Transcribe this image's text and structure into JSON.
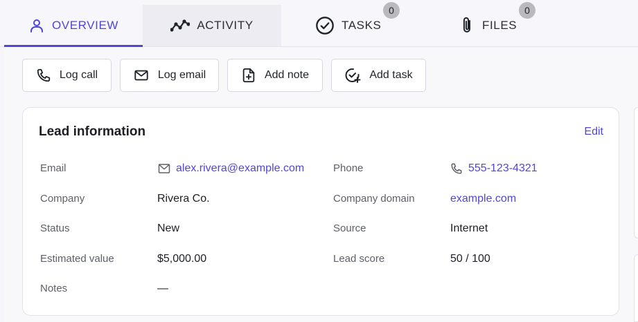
{
  "tabs": [
    {
      "label": "OVERVIEW",
      "icon": "user-icon",
      "active": true
    },
    {
      "label": "ACTIVITY",
      "icon": "activity-icon"
    },
    {
      "label": "TASKS",
      "icon": "check-circle-icon",
      "badge": "0"
    },
    {
      "label": "FILES",
      "icon": "paperclip-icon",
      "badge": "0"
    }
  ],
  "actions": {
    "log_call": "Log call",
    "log_email": "Log email",
    "add_note": "Add note",
    "add_task": "Add task"
  },
  "lead": {
    "title": "Lead information",
    "edit": "Edit",
    "labels": {
      "email": "Email",
      "phone": "Phone",
      "company": "Company",
      "company_domain": "Company domain",
      "status": "Status",
      "source": "Source",
      "estimated_value": "Estimated value",
      "lead_score": "Lead score",
      "notes": "Notes"
    },
    "values": {
      "email": "alex.rivera@example.com",
      "phone": "555-123-4321",
      "company": "Rivera Co.",
      "company_domain": "example.com",
      "status": "New",
      "source": "Internet",
      "estimated_value": "$5,000.00",
      "lead_score": "50 / 100",
      "notes": "—"
    }
  },
  "colors": {
    "accent": "#5046d6",
    "badge": "#b9b9be"
  }
}
